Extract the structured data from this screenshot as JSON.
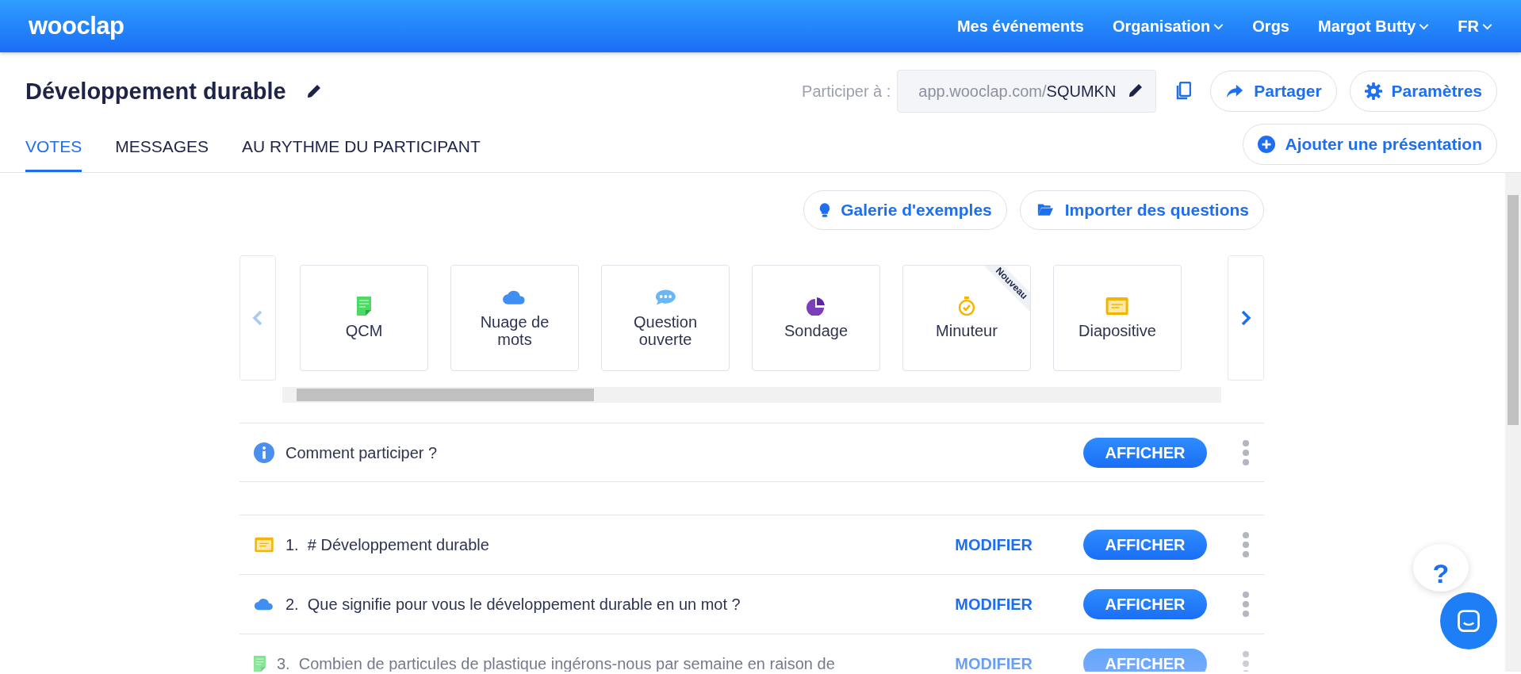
{
  "header": {
    "logo": "wooclap",
    "nav": [
      {
        "label": "Mes événements",
        "dropdown": false
      },
      {
        "label": "Organisation",
        "dropdown": true
      },
      {
        "label": "Orgs",
        "dropdown": false
      },
      {
        "label": "Margot Butty",
        "dropdown": true
      },
      {
        "label": "FR",
        "dropdown": true
      }
    ]
  },
  "event": {
    "title": "Développement durable",
    "join_label": "Participer à :",
    "join_url_prefix": "app.wooclap.com/",
    "join_code": "SQUMKN"
  },
  "actions": [
    {
      "label": "Partager",
      "kind": "share"
    },
    {
      "label": "Paramètres",
      "kind": "settings"
    },
    {
      "label": "Ajouter une présentation",
      "kind": "add"
    }
  ],
  "tabs": [
    {
      "label": "VOTES",
      "selected": true
    },
    {
      "label": "MESSAGES",
      "selected": false
    },
    {
      "label": "AU RYTHME DU PARTICIPANT",
      "selected": false
    }
  ],
  "toolbar": [
    {
      "label": "Galerie d'exemples",
      "kind": "bulb"
    },
    {
      "label": "Importer des questions",
      "kind": "folder"
    }
  ],
  "carousel": {
    "prev_disabled": true,
    "next_disabled": false
  },
  "question_types": [
    {
      "label": "QCM",
      "kind": "mcq"
    },
    {
      "label": "Nuage de mots",
      "kind": "cloud"
    },
    {
      "label": "Question ouverte",
      "kind": "chat"
    },
    {
      "label": "Sondage",
      "kind": "poll"
    },
    {
      "label": "Minuteur",
      "kind": "timer",
      "badge": "Nouveau"
    },
    {
      "label": "Diapositive",
      "kind": "slide"
    }
  ],
  "intro_row": {
    "text": "Comment participer ?",
    "show_label": "AFFICHER"
  },
  "questions": [
    {
      "number": "1.",
      "text": "# Développement durable",
      "kind": "slide",
      "edit_label": "MODIFIER",
      "show_label": "AFFICHER",
      "faded": false
    },
    {
      "number": "2.",
      "text": "Que signifie pour vous le développement durable en un mot ?",
      "kind": "cloud",
      "edit_label": "MODIFIER",
      "show_label": "AFFICHER",
      "faded": false
    },
    {
      "number": "3.",
      "text": "Combien de particules de plastique ingérons-nous par semaine en raison de",
      "kind": "mcq",
      "edit_label": "MODIFIER",
      "show_label": "AFFICHER",
      "faded": true
    }
  ],
  "help": {
    "label": "?"
  }
}
